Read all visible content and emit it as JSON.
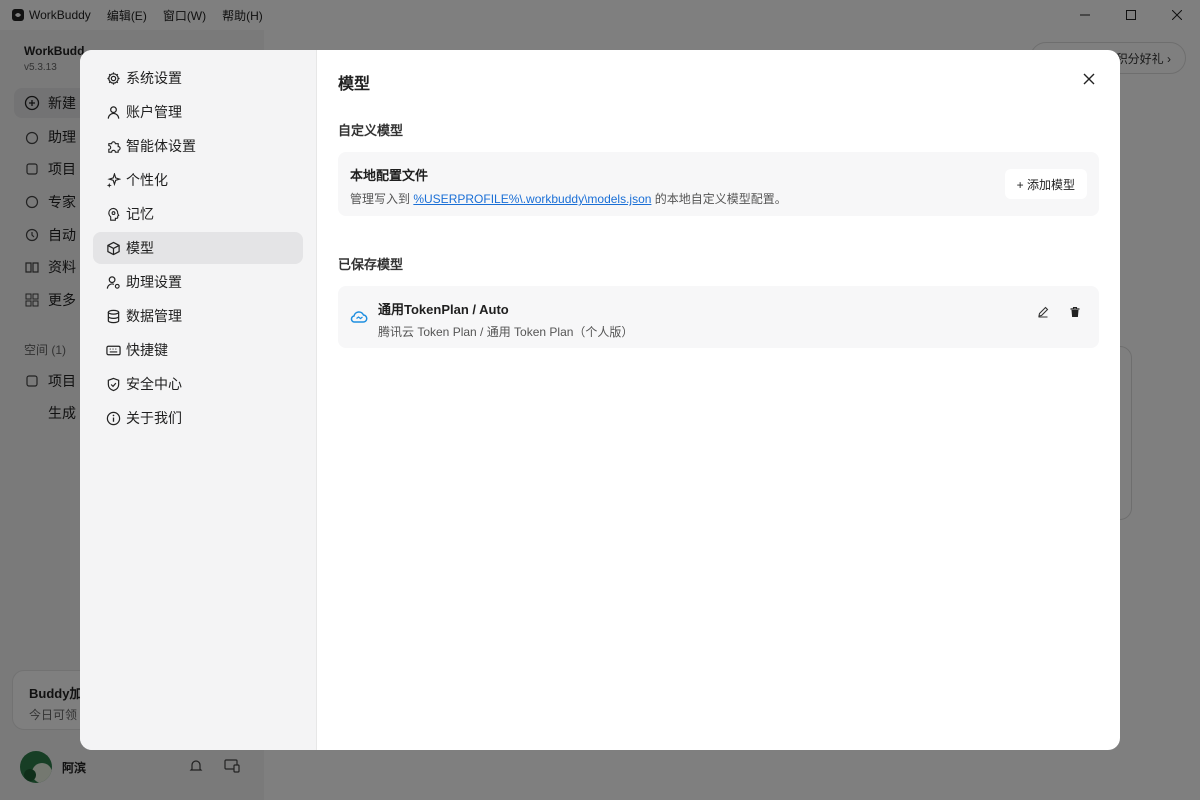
{
  "titlebar": {
    "app_name": "WorkBuddy",
    "menus": [
      "编辑(E)",
      "窗口(W)",
      "帮助(H)"
    ]
  },
  "background": {
    "brand": "WorkBudd",
    "version": "v5.3.13",
    "nav": [
      "新建",
      "助理",
      "项目",
      "专家",
      "自动",
      "资料",
      "更多"
    ],
    "section": "空间 (1)",
    "project": "项目",
    "project_sub": "生成",
    "promo_title": "Buddy加",
    "promo_sub": "今日可领",
    "user_name": "阿滨",
    "pill_text": "积分好礼 ›"
  },
  "settings": {
    "nav": [
      {
        "label": "系统设置",
        "icon": "gear-icon"
      },
      {
        "label": "账户管理",
        "icon": "user-icon"
      },
      {
        "label": "智能体设置",
        "icon": "puzzle-icon"
      },
      {
        "label": "个性化",
        "icon": "sparkle-icon"
      },
      {
        "label": "记忆",
        "icon": "brain-icon"
      },
      {
        "label": "模型",
        "icon": "cube-icon",
        "active": true
      },
      {
        "label": "助理设置",
        "icon": "user-gear-icon"
      },
      {
        "label": "数据管理",
        "icon": "database-icon"
      },
      {
        "label": "快捷键",
        "icon": "keyboard-icon"
      },
      {
        "label": "安全中心",
        "icon": "shield-icon"
      },
      {
        "label": "关于我们",
        "icon": "info-icon"
      }
    ],
    "page_title": "模型",
    "custom_section": "自定义模型",
    "local_config": {
      "title": "本地配置文件",
      "desc_prefix": "管理写入到 ",
      "path": "%USERPROFILE%\\.workbuddy\\models.json",
      "desc_suffix": " 的本地自定义模型配置。",
      "add_button": "+ 添加模型"
    },
    "saved_section": "已保存模型",
    "saved_models": [
      {
        "name": "通用TokenPlan / Auto",
        "provider": "腾讯云 Token Plan / 通用 Token Plan（个人版）"
      }
    ]
  },
  "colors": {
    "accent_link": "#1a6fd6",
    "cloud_icon": "#1f8fe0",
    "active_nav_bg": "#e4e4e6"
  }
}
